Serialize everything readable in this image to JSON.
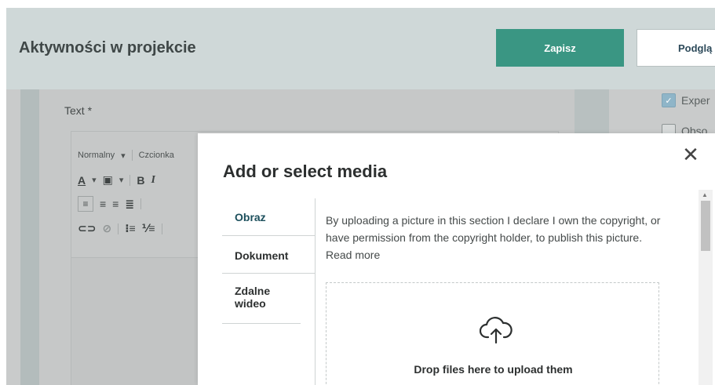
{
  "header": {
    "title": "Aktywności w projekcie",
    "save_label": "Zapisz",
    "preview_label": "Podglą"
  },
  "form": {
    "text_label": "Text *",
    "editor_toolbar": {
      "format_select": "Normalny",
      "font_select": "Czcionka",
      "row1_icons": [
        "text-color-icon",
        "bg-color-icon",
        "bold-icon",
        "italic-icon"
      ],
      "row2_icons": [
        "align-left-icon",
        "align-center-icon",
        "align-right-icon",
        "justify-icon"
      ],
      "row3_icons": [
        "link-icon",
        "unlink-icon",
        "bullet-list-icon",
        "numbered-list-icon"
      ]
    },
    "right_panel": {
      "items": [
        {
          "label": "Exper",
          "checked": true
        },
        {
          "label": "Obso",
          "checked": false
        }
      ]
    }
  },
  "modal": {
    "title": "Add or select media",
    "tabs": [
      {
        "label": "Obraz",
        "active": true
      },
      {
        "label": "Dokument",
        "active": false
      },
      {
        "label": "Zdalne wideo",
        "active": false
      }
    ],
    "notice": "By uploading a picture in this section I declare I own the copyright, or have permission from the copyright holder, to publish this picture. Read more",
    "dropzone_text": "Drop files here to upload them",
    "close_icon": "close-icon",
    "upload_icon": "cloud-upload-icon"
  },
  "colors": {
    "accent": "#3a9683",
    "header_bg": "#cfd8d8",
    "overlay_bg": "#c9cbcb",
    "tab_active": "#1c4f5c"
  }
}
